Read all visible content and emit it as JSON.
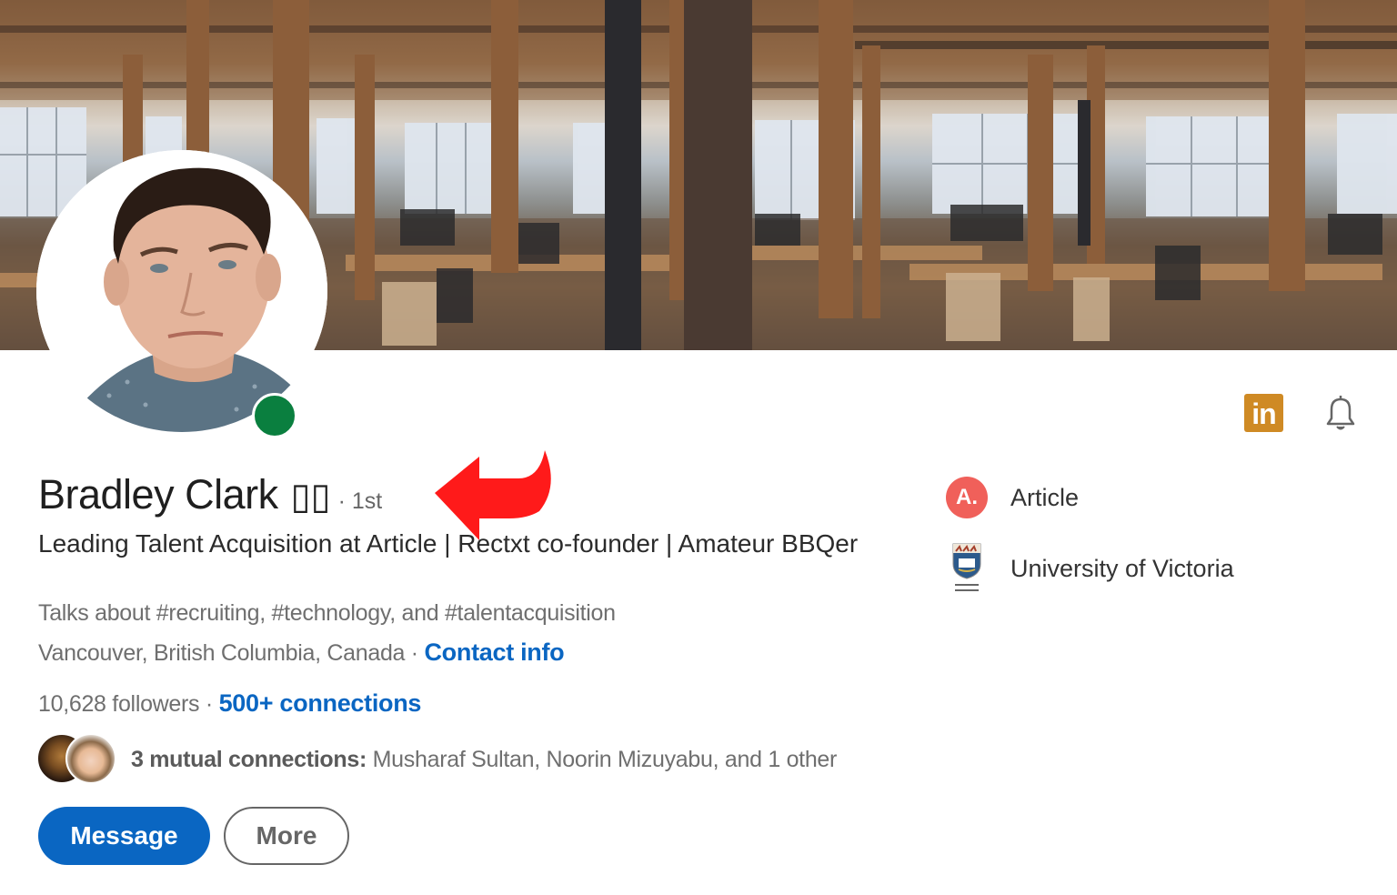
{
  "profile": {
    "name": "Bradley Clark",
    "name_suffix_glyphs": "▯▯",
    "connection_degree": "· 1st",
    "headline": "Leading Talent Acquisition at Article | Rectxt co-founder | Amateur BBQer",
    "talks_about": "Talks about #recruiting, #technology, and #talentacquisition",
    "location": "Vancouver, British Columbia, Canada",
    "location_separator": " · ",
    "contact_info_label": "Contact info",
    "followers": "10,628 followers",
    "followers_separator": " · ",
    "connections_label": "500+ connections",
    "online_status": "online",
    "online_color": "#0a7f3f"
  },
  "mutual": {
    "label": "3 mutual connections:",
    "names": " Musharaf Sultan, Noorin Mizuyabu, and 1 other"
  },
  "actions": {
    "message_label": "Message",
    "more_label": "More",
    "primary_color": "#0a66c2"
  },
  "organizations": [
    {
      "name": "Article",
      "logo_text": "A.",
      "logo_color": "#f0605a",
      "icon": "article-logo-icon"
    },
    {
      "name": "University of Victoria",
      "icon": "university-crest-icon"
    }
  ],
  "top_icons": {
    "linkedin_text": "in",
    "linkedin_color": "#cf8a24",
    "bell": "bell-icon"
  },
  "annotation": {
    "type": "red-arrow",
    "color": "#ff1a1a"
  }
}
